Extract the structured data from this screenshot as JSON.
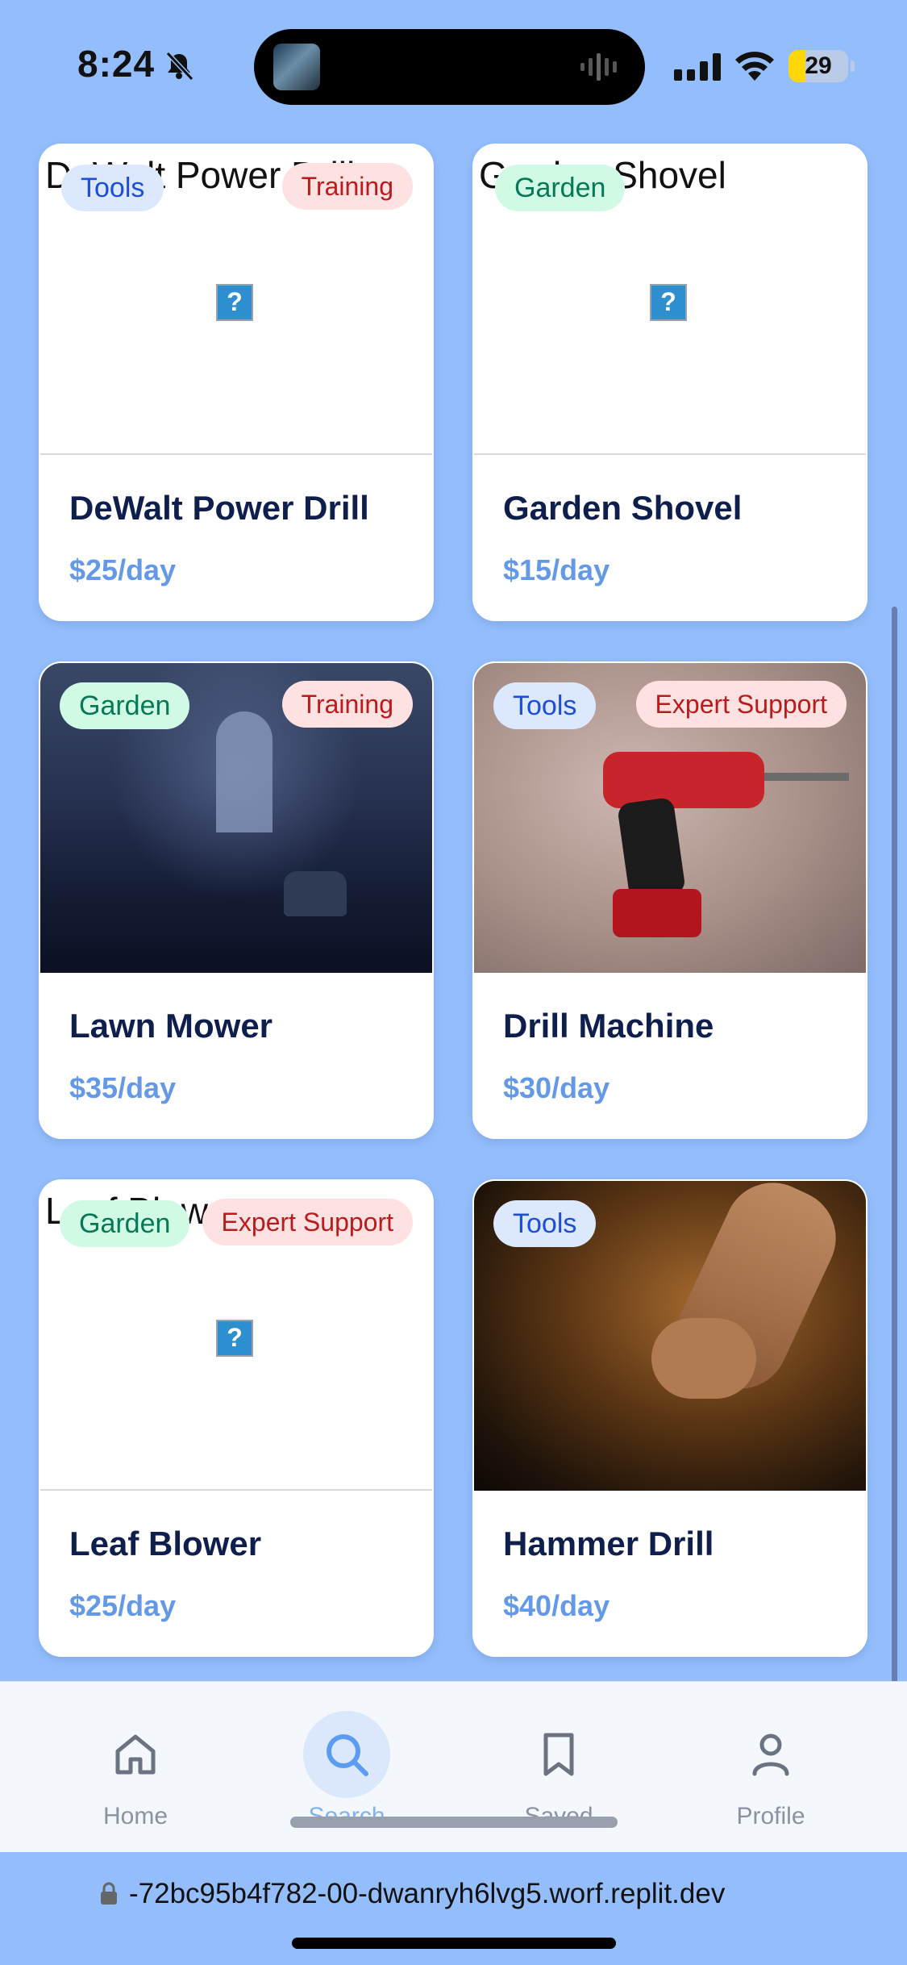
{
  "status_bar": {
    "time": "8:24",
    "battery_level": "29",
    "battery_fraction": 0.29,
    "icons": [
      "bell-slash-icon",
      "signal-icon",
      "wifi-icon",
      "battery-icon"
    ]
  },
  "cards": [
    {
      "title": "DeWalt Power Drill",
      "price": "$25/day",
      "category": "Tools",
      "extra_badge": "Training",
      "image": "broken",
      "alt_text": "DeWalt Power Drill"
    },
    {
      "title": "Garden Shovel",
      "price": "$15/day",
      "category": "Garden",
      "extra_badge": "",
      "image": "broken",
      "alt_text": "Garden Shovel"
    },
    {
      "title": "Lawn Mower",
      "price": "$35/day",
      "category": "Garden",
      "extra_badge": "Training",
      "image": "dark-room-photo"
    },
    {
      "title": "Drill Machine",
      "price": "$30/day",
      "category": "Tools",
      "extra_badge": "Expert Support",
      "image": "red-drill-photo"
    },
    {
      "title": "Leaf Blower",
      "price": "$25/day",
      "category": "Garden",
      "extra_badge": "Expert Support",
      "image": "broken",
      "alt_text": "Leaf Blow"
    },
    {
      "title": "Hammer Drill",
      "price": "$40/day",
      "category": "Tools",
      "extra_badge": "",
      "image": "engine-repair-photo"
    }
  ],
  "colors": {
    "page_background": "#93bdfb",
    "price": "#6499e8",
    "tools_badge_bg": "#dbe8fe",
    "garden_badge_bg": "#d1fae5",
    "extra_badge_bg": "#fee2e2",
    "active_nav": "#7fb2f0"
  },
  "nav": {
    "items": [
      {
        "label": "Home",
        "icon": "home-icon",
        "active": false
      },
      {
        "label": "Search",
        "icon": "search-icon",
        "active": true
      },
      {
        "label": "Saved",
        "icon": "bookmark-icon",
        "active": false
      },
      {
        "label": "Profile",
        "icon": "user-icon",
        "active": false
      }
    ]
  },
  "browser": {
    "url": "-72bc95b4f782-00-dwanryh6lvg5.worf.replit.dev"
  }
}
